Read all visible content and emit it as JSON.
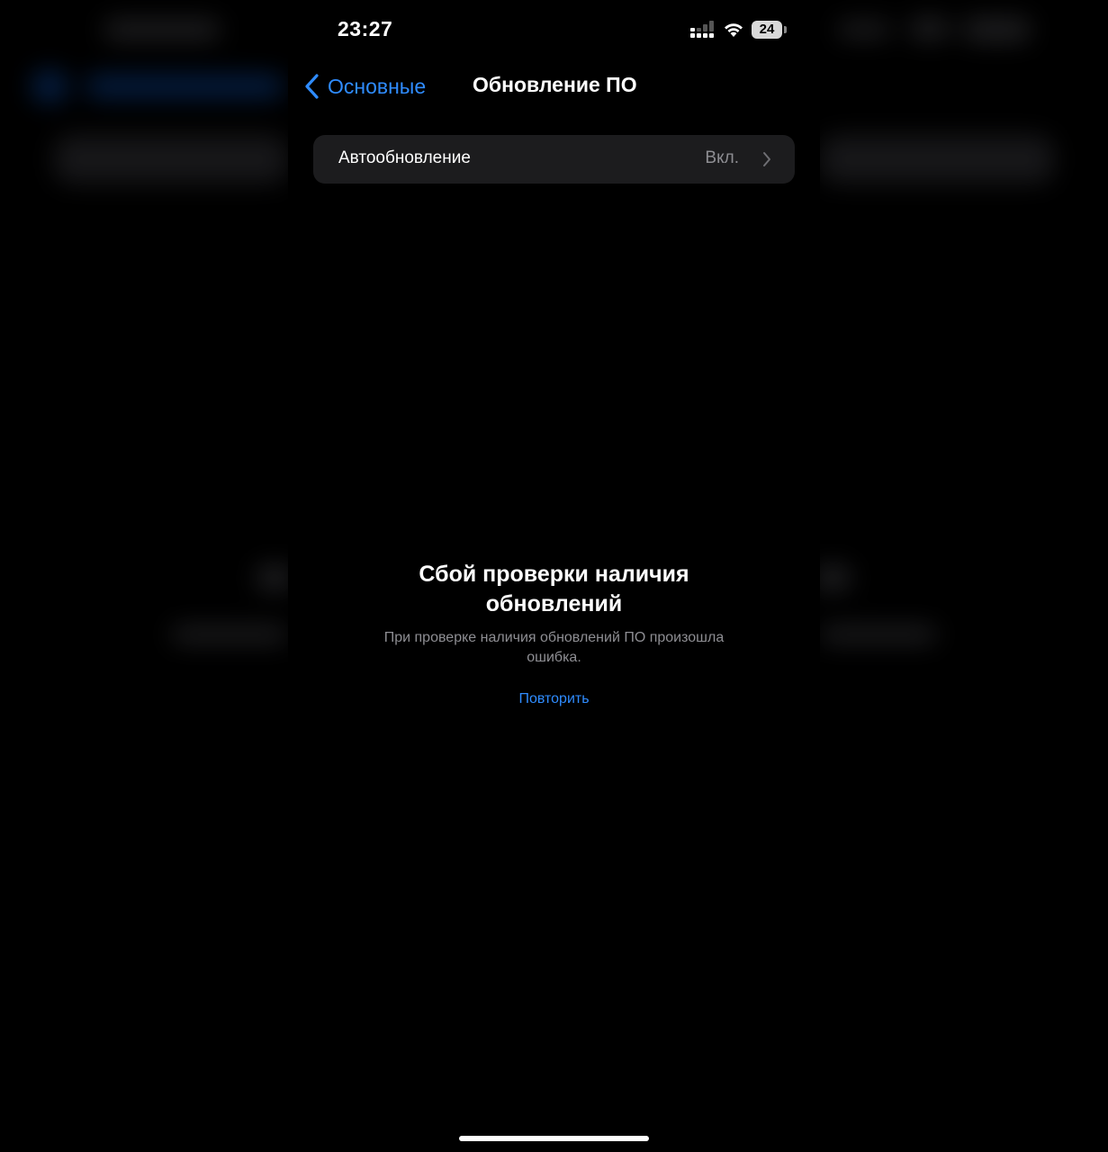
{
  "status_bar": {
    "time": "23:27",
    "battery_level": "24",
    "icons": [
      "cellular-signal-icon",
      "wifi-icon",
      "battery-icon"
    ]
  },
  "nav": {
    "back_label": "Основные",
    "title": "Обновление ПО"
  },
  "settings": {
    "auto_update": {
      "label": "Автообновление",
      "value": "Вкл."
    }
  },
  "error": {
    "title": "Сбой проверки наличия обновлений",
    "message": "При проверке наличия обновлений ПО произошла ошибка.",
    "retry_label": "Повторить"
  },
  "colors": {
    "accent": "#2f8cff",
    "background": "#000000",
    "cell": "#1c1c1e",
    "secondary_text": "#8e8e93"
  }
}
